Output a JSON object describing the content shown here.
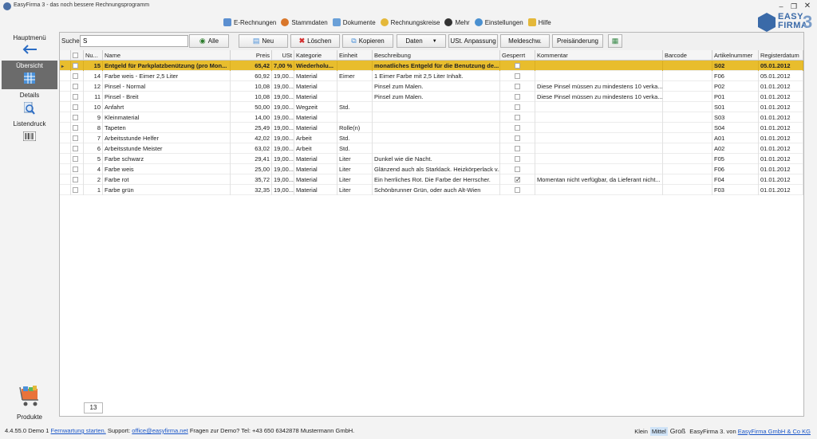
{
  "window": {
    "title": "EasyFirma 3 - das noch bessere Rechnungsprogramm",
    "minimize": "–",
    "restore": "❐",
    "close": "✕"
  },
  "menu": [
    {
      "label": "E-Rechnungen",
      "icon": "e-invoice-icon",
      "color": "#5b8fd0"
    },
    {
      "label": "Stammdaten",
      "icon": "people-icon",
      "color": "#d9772b"
    },
    {
      "label": "Dokumente",
      "icon": "documents-icon",
      "color": "#6aa0d8"
    },
    {
      "label": "Rechnungskreise",
      "icon": "circle-icon",
      "color": "#e4b83a"
    },
    {
      "label": "Mehr",
      "icon": "more-icon",
      "color": "#333333"
    },
    {
      "label": "Einstellungen",
      "icon": "gear-icon",
      "color": "#4a90d0"
    },
    {
      "label": "Hilfe",
      "icon": "help-icon",
      "color": "#e4b83a"
    }
  ],
  "logo": {
    "line1": "EASY",
    "line2": "FIRMA",
    "version": "3"
  },
  "sidebar": {
    "main_menu": "Hauptmenü",
    "overview": "Übersicht",
    "details": "Details",
    "print_list": "Listendruck",
    "products": "Produkte"
  },
  "toolbar": {
    "search_label": "Suche:",
    "search_value": "S",
    "all": "Alle",
    "new": "Neu",
    "delete": "Löschen",
    "copy": "Kopieren",
    "data": "Daten",
    "vat_adjust": "USt. Anpassung",
    "report": "Meldeschw.",
    "price_change": "Preisänderung"
  },
  "columns": [
    "Nu...",
    "Name",
    "Preis",
    "USt",
    "Kategorie",
    "Einheit",
    "Beschreibung",
    "Gesperrt",
    "Kommentar",
    "Barcode",
    "Artikelnummer",
    "Registerdatum"
  ],
  "rows": [
    {
      "nr": "15",
      "name": "Entgeld für Parkplatzbenützung (pro Mon...",
      "preis": "65,42",
      "ust": "7,00 %",
      "kat": "Wiederholu...",
      "einheit": "",
      "beschr": "monatliches Entgeld für die Benutzung de...",
      "gesperrt": false,
      "komm": "",
      "barcode": "",
      "artnr": "S02",
      "datum": "05.01.2012",
      "selected": true
    },
    {
      "nr": "14",
      "name": "Farbe weis - Eimer 2,5 Liter",
      "preis": "60,92",
      "ust": "19,00...",
      "kat": "Material",
      "einheit": "Eimer",
      "beschr": "1 Eimer Farbe mit 2,5 Liter Inhalt.",
      "gesperrt": false,
      "komm": "",
      "barcode": "",
      "artnr": "F06",
      "datum": "05.01.2012"
    },
    {
      "nr": "12",
      "name": "Pinsel - Normal",
      "preis": "10,08",
      "ust": "19,00...",
      "kat": "Material",
      "einheit": "",
      "beschr": "Pinsel zum Malen.",
      "gesperrt": false,
      "komm": "Diese Pinsel müssen zu mindestens 10 verka...",
      "barcode": "",
      "artnr": "P02",
      "datum": "01.01.2012"
    },
    {
      "nr": "11",
      "name": "Pinsel - Breit",
      "preis": "10,08",
      "ust": "19,00...",
      "kat": "Material",
      "einheit": "",
      "beschr": "Pinsel zum Malen.",
      "gesperrt": false,
      "komm": "Diese Pinsel müssen zu mindestens 10 verka...",
      "barcode": "",
      "artnr": "P01",
      "datum": "01.01.2012"
    },
    {
      "nr": "10",
      "name": "Anfahrt",
      "preis": "50,00",
      "ust": "19,00...",
      "kat": "Wegzeit",
      "einheit": "Std.",
      "beschr": "",
      "gesperrt": false,
      "komm": "",
      "barcode": "",
      "artnr": "S01",
      "datum": "01.01.2012"
    },
    {
      "nr": "9",
      "name": "Kleinmaterial",
      "preis": "14,00",
      "ust": "19,00...",
      "kat": "Material",
      "einheit": "",
      "beschr": "",
      "gesperrt": false,
      "komm": "",
      "barcode": "",
      "artnr": "S03",
      "datum": "01.01.2012"
    },
    {
      "nr": "8",
      "name": "Tapeten",
      "preis": "25,49",
      "ust": "19,00...",
      "kat": "Material",
      "einheit": "Rolle(n)",
      "beschr": "",
      "gesperrt": false,
      "komm": "",
      "barcode": "",
      "artnr": "S04",
      "datum": "01.01.2012"
    },
    {
      "nr": "7",
      "name": "Arbeitsstunde Helfer",
      "preis": "42,02",
      "ust": "19,00...",
      "kat": "Arbeit",
      "einheit": "Std.",
      "beschr": "",
      "gesperrt": false,
      "komm": "",
      "barcode": "",
      "artnr": "A01",
      "datum": "01.01.2012"
    },
    {
      "nr": "6",
      "name": "Arbeitsstunde Meister",
      "preis": "63,02",
      "ust": "19,00...",
      "kat": "Arbeit",
      "einheit": "Std.",
      "beschr": "",
      "gesperrt": false,
      "komm": "",
      "barcode": "",
      "artnr": "A02",
      "datum": "01.01.2012"
    },
    {
      "nr": "5",
      "name": "Farbe schwarz",
      "preis": "29,41",
      "ust": "19,00...",
      "kat": "Material",
      "einheit": "Liter",
      "beschr": "Dunkel wie die Nacht.",
      "gesperrt": false,
      "komm": "",
      "barcode": "",
      "artnr": "F05",
      "datum": "01.01.2012"
    },
    {
      "nr": "4",
      "name": "Farbe weis",
      "preis": "25,00",
      "ust": "19,00...",
      "kat": "Material",
      "einheit": "Liter",
      "beschr": "Glänzend auch als Starklack. Heizkörperlack v...",
      "gesperrt": false,
      "komm": "",
      "barcode": "",
      "artnr": "F06",
      "datum": "01.01.2012"
    },
    {
      "nr": "2",
      "name": "Farbe rot",
      "preis": "35,72",
      "ust": "19,00...",
      "kat": "Material",
      "einheit": "Liter",
      "beschr": "Ein herrliches Rot. Die Farbe der Herrscher.",
      "gesperrt": true,
      "komm": "Momentan nicht verfügbar, da Lieferant nicht...",
      "barcode": "",
      "artnr": "F04",
      "datum": "01.01.2012"
    },
    {
      "nr": "1",
      "name": "Farbe grün",
      "preis": "32,35",
      "ust": "19,00...",
      "kat": "Material",
      "einheit": "Liter",
      "beschr": "Schönbrunner Grün, oder auch Alt-Wien",
      "gesperrt": false,
      "komm": "",
      "barcode": "",
      "artnr": "F03",
      "datum": "01.01.2012"
    }
  ],
  "record_count": "13",
  "status": {
    "version": "4.4.55.0 Demo 1",
    "remote_link": "Fernwartung starten.",
    "support_text": "Support:",
    "support_email": "office@easyfirma.net",
    "demo_text": "Fragen zur Demo? Tel: +43 650 6342878 Mustermann GmbH.",
    "size_small": "Klein",
    "size_medium": "Mittel",
    "size_large": "Groß",
    "brand_text": "EasyFirma 3. von",
    "brand_link": "EasyFirma GmbH & Co KG"
  },
  "colors": {
    "selected_row": "#e8bd2d",
    "accent": "#3a6aa8",
    "link": "#1a56c8"
  }
}
